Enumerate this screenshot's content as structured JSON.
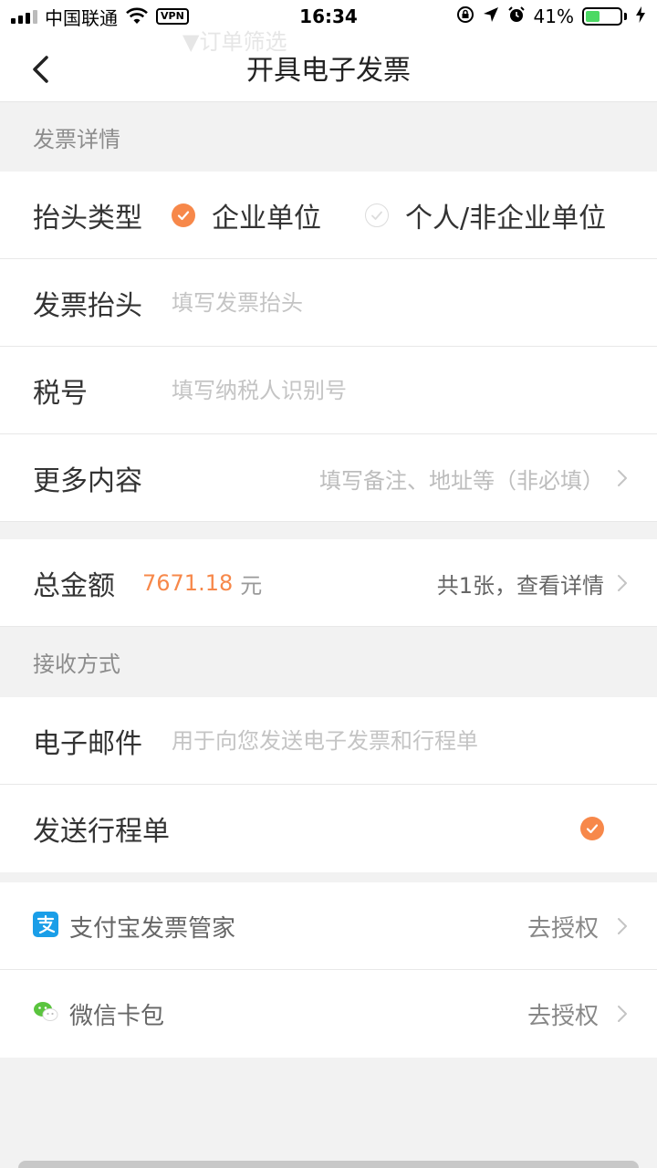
{
  "status_bar": {
    "carrier": "中国联通",
    "vpn": "VPN",
    "time": "16:34",
    "battery_percent_text": "41%",
    "battery_level": 0.41,
    "battery_color": "#4cd964"
  },
  "background_text": "▼订单筛选",
  "header": {
    "title": "开具电子发票",
    "back_icon": "chevron-left-icon"
  },
  "invoice_details": {
    "section_title": "发票详情",
    "title_type": {
      "label": "抬头类型",
      "options": [
        {
          "label": "企业单位",
          "selected": true
        },
        {
          "label": "个人/非企业单位",
          "selected": false
        }
      ]
    },
    "invoice_title": {
      "label": "发票抬头",
      "placeholder": "填写发票抬头",
      "value": ""
    },
    "tax_number": {
      "label": "税号",
      "placeholder": "填写纳税人识别号",
      "value": ""
    },
    "more_content": {
      "label": "更多内容",
      "placeholder": "填写备注、地址等（非必填）"
    }
  },
  "total": {
    "label": "总金额",
    "amount": "7671.18",
    "unit": "元",
    "detail_link": "共1张，查看详情"
  },
  "receive": {
    "section_title": "接收方式",
    "email": {
      "label": "电子邮件",
      "placeholder": "用于向您发送电子发票和行程单",
      "value": ""
    },
    "send_itinerary": {
      "label": "发送行程单",
      "checked": true
    }
  },
  "authorizations": [
    {
      "icon": "alipay-icon",
      "label": "支付宝发票管家",
      "action": "去授权"
    },
    {
      "icon": "wechat-icon",
      "label": "微信卡包",
      "action": "去授权"
    }
  ],
  "colors": {
    "accent": "#f7884a",
    "alipay": "#1a9ee8",
    "wechat": "#5ac43e"
  }
}
